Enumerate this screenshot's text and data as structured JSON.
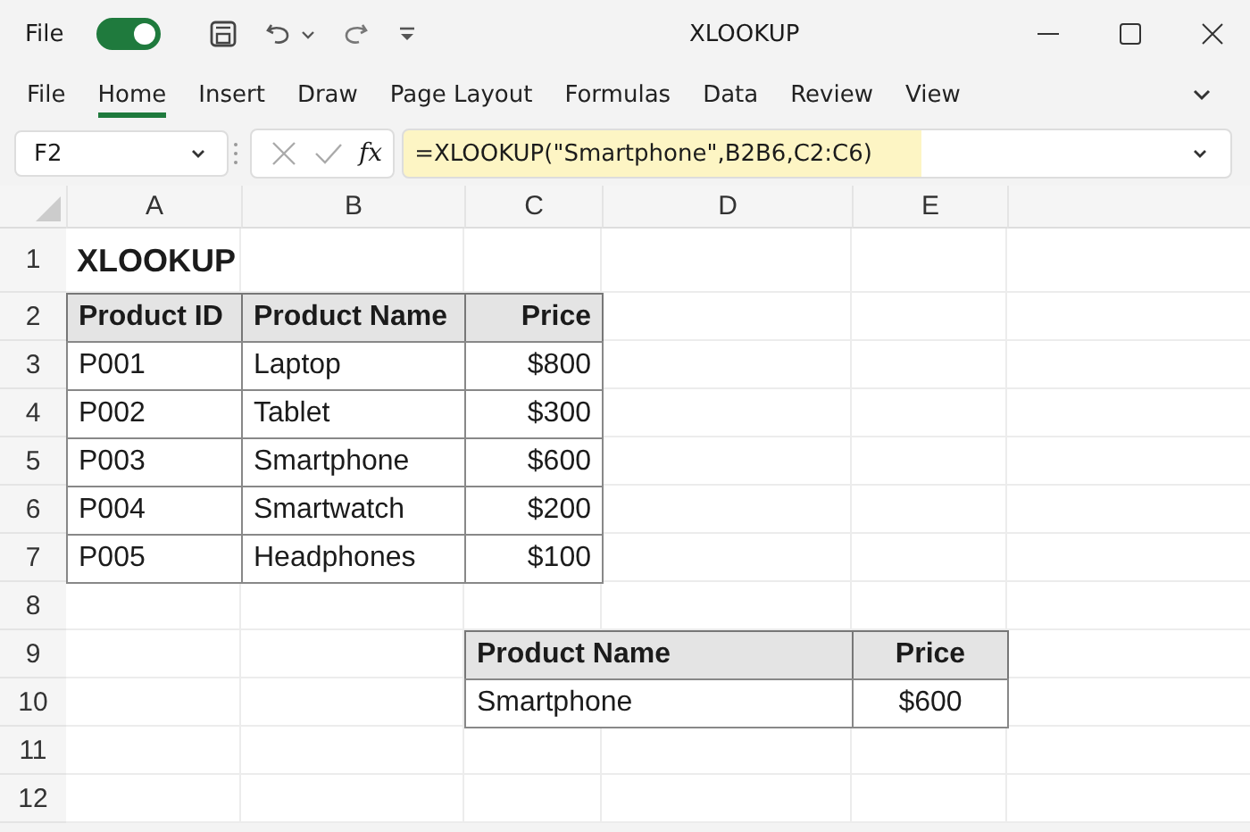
{
  "title_bar": {
    "file_label": "File",
    "autosave": {
      "on": true
    },
    "title": "XLOOKUP"
  },
  "tabs": [
    {
      "label": "File",
      "selected": false
    },
    {
      "label": "Home",
      "selected": true
    },
    {
      "label": "Insert",
      "selected": false
    },
    {
      "label": "Draw",
      "selected": false
    },
    {
      "label": "Page Layout",
      "selected": false
    },
    {
      "label": "Formulas",
      "selected": false
    },
    {
      "label": "Data",
      "selected": false
    },
    {
      "label": "Review",
      "selected": false
    },
    {
      "label": "View",
      "selected": false
    }
  ],
  "formula_bar": {
    "name_box": "F2",
    "function_label": "fx",
    "formula": "=XLOOKUP(\"Smartphone\",B2B6,C2:C6)"
  },
  "sheet": {
    "columns": [
      "A",
      "B",
      "C",
      "D",
      "E"
    ],
    "row_numbers": [
      "1",
      "2",
      "3",
      "4",
      "5",
      "6",
      "7",
      "8",
      "9",
      "10",
      "11",
      "12"
    ],
    "title": "XLOOKUP",
    "products": {
      "header": [
        "Product ID",
        "Product Name",
        "Price"
      ],
      "rows": [
        [
          "P001",
          "Laptop",
          "$800"
        ],
        [
          "P002",
          "Tablet",
          "$300"
        ],
        [
          "P003",
          "Smartphone",
          "$600"
        ],
        [
          "P004",
          "Smartwatch",
          "$200"
        ],
        [
          "P005",
          "Headphones",
          "$100"
        ]
      ]
    },
    "result": {
      "header": [
        "Product Name",
        "Price"
      ],
      "rows": [
        [
          "Smartphone",
          "$600"
        ]
      ]
    }
  }
}
